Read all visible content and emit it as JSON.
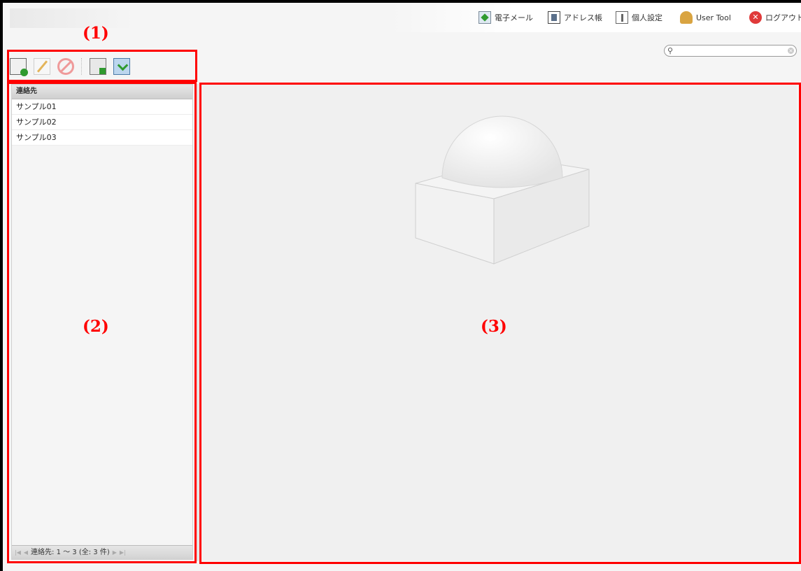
{
  "topnav": {
    "items": [
      {
        "label": "電子メール",
        "icon": "mail-icon"
      },
      {
        "label": "アドレス帳",
        "icon": "address-book-icon"
      },
      {
        "label": "個人設定",
        "icon": "personal-settings-icon"
      },
      {
        "label": "User Tool",
        "icon": "user-tool-icon"
      },
      {
        "label": "ログアウト",
        "icon": "logout-icon"
      }
    ]
  },
  "search": {
    "placeholder": "",
    "value": ""
  },
  "toolbar": {
    "icons": [
      "add-contact-icon",
      "edit-icon",
      "delete-icon",
      "import-icon",
      "export-icon"
    ]
  },
  "contacts": {
    "header": "連絡先",
    "items": [
      "サンプル01",
      "サンプル02",
      "サンプル03"
    ],
    "pager_text": "連絡先: 1 〜 3 (全: 3 件)"
  },
  "callouts": [
    "(1)",
    "(2)",
    "(3)"
  ],
  "colors": {
    "highlight": "#ff0000",
    "frame": "#000000"
  }
}
